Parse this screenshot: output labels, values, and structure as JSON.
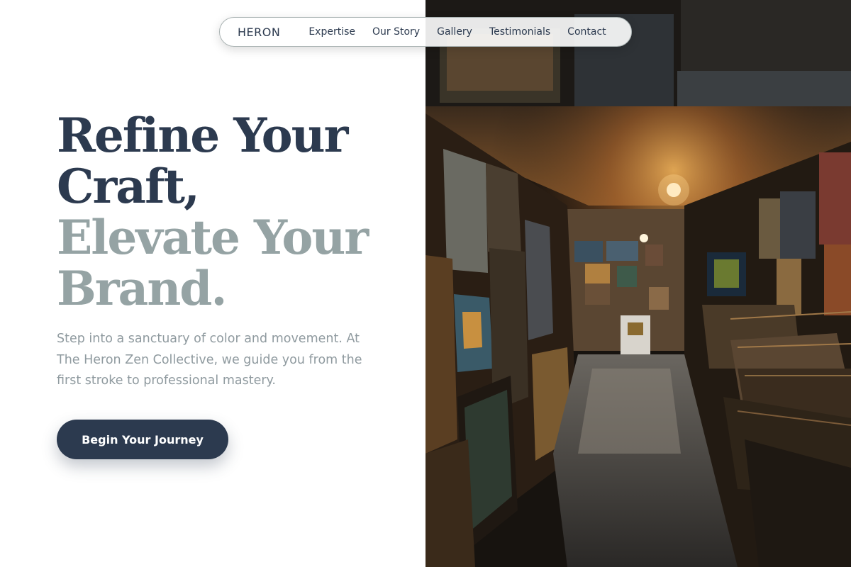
{
  "nav": {
    "brand": "HERON",
    "items": [
      "Expertise",
      "Our Story",
      "Gallery",
      "Testimonials",
      "Contact"
    ]
  },
  "hero": {
    "headline_dark": [
      "Refine Your",
      "Craft,"
    ],
    "headline_muted": [
      "Elevate Your",
      "Brand."
    ],
    "description": "Step into a sanctuary of color and movement. At The Heron Zen Collective, we guide you from the first stroke to professional mastery.",
    "cta_label": "Begin Your Journey"
  },
  "colors": {
    "primary": "#2c3a4f",
    "muted": "#95a3a4",
    "body_text": "#8f9a9f",
    "background": "#ffffff"
  }
}
